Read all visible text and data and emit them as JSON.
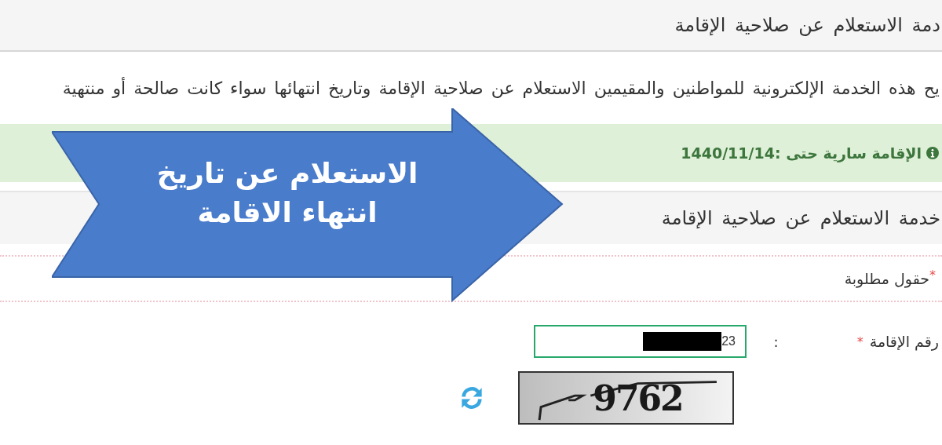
{
  "page_header": {
    "title": "دمة الاستعلام عن صلاحية الإقامة"
  },
  "description": "يح هذه الخدمة الإلكترونية للمواطنين والمقيمين الاستعلام عن صلاحية الإقامة وتاريخ انتهائها سواء كانت صالحة أو منتهية",
  "alert": {
    "text": "الإقامة سارية حتى :1440/11/14"
  },
  "form_panel": {
    "title": "خدمة الاستعلام عن صلاحية الإقامة",
    "required_note": "حقول مطلوبة",
    "required_mark": "*",
    "fields": [
      {
        "label": "رقم الإقامة",
        "required_mark": "*",
        "separator": ":",
        "value": "23",
        "redacted": true
      }
    ],
    "captcha": {
      "code": "9762"
    }
  },
  "callout": {
    "lines": [
      "الاستعلام عن تاريخ",
      "انتهاء الاقامة"
    ]
  }
}
